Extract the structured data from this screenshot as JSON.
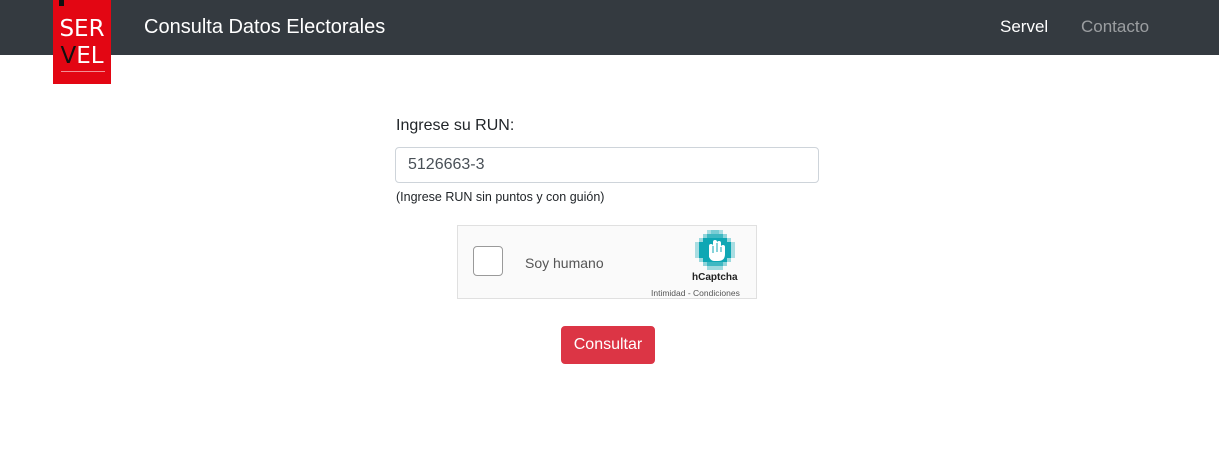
{
  "header": {
    "logo_line1": "SER",
    "logo_line2_v": "V",
    "logo_line2_rest": "EL",
    "brand": "Consulta Datos Electorales",
    "nav": {
      "servel": "Servel",
      "contacto": "Contacto"
    }
  },
  "form": {
    "run_label": "Ingrese su RUN:",
    "run_value": "5126663-3",
    "run_hint": "(Ingrese RUN sin puntos y con guión)",
    "submit_label": "Consultar"
  },
  "captcha": {
    "label": "Soy humano",
    "brand": "hCaptcha",
    "links": "Intimidad - Condiciones",
    "checked": false
  },
  "colors": {
    "navbar": "#343a40",
    "logo_red": "#e30613",
    "button_red": "#dc3545",
    "hcaptcha_teal": "#0fa7b4"
  }
}
